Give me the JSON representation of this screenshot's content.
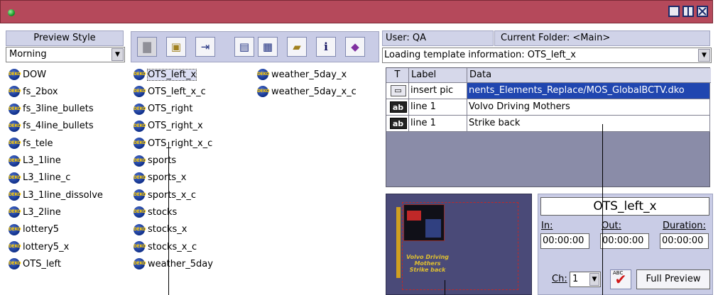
{
  "left_panel": {
    "preview_style_label": "Preview Style",
    "preview_style_value": "Morning",
    "templates_col1": [
      "DOW",
      "fs_2box",
      "fs_3line_bullets",
      "fs_4line_bullets",
      "fs_tele",
      "L3_1line",
      "L3_1line_c",
      "L3_1line_dissolve",
      "L3_2line",
      "lottery5",
      "lottery5_x",
      "OTS_left"
    ],
    "templates_col2": [
      "OTS_left_x",
      "OTS_left_x_c",
      "OTS_right",
      "OTS_right_x",
      "OTS_right_x_c",
      "sports",
      "sports_x",
      "sports_x_c",
      "stocks",
      "stocks_x",
      "stocks_x_c",
      "weather_5day"
    ],
    "templates_col3": [
      "weather_5day_x",
      "weather_5day_x_c"
    ],
    "selected_template": "OTS_left_x"
  },
  "toolbar": {
    "buttons": [
      "folder-icon",
      "template-icon",
      "import-icon",
      "list-view-icon",
      "detail-view-icon",
      "open-folder-icon",
      "info-icon",
      "eraser-icon"
    ]
  },
  "right_panel": {
    "user": "User: QA",
    "current_folder": "Current Folder: <Main>",
    "status": "Loading template information: OTS_left_x",
    "grid_headers": {
      "t": "T",
      "label": "Label",
      "data": "Data"
    },
    "grid_rows": [
      {
        "type": "picture",
        "label": "insert pic",
        "data": "nents_Elements_Replace/MOS_GlobalBCTV.dko"
      },
      {
        "type": "text",
        "label": "line 1",
        "data": "Volvo Driving Mothers"
      },
      {
        "type": "text",
        "label": "line 1",
        "data": "Strike back"
      }
    ],
    "thumbnail_caption_1": "Volvo Driving Mothers",
    "thumbnail_caption_2": "Strike back",
    "template_name": "OTS_left_x",
    "in_label": "In:",
    "out_label": "Out:",
    "duration_label": "Duration:",
    "in_value": "00:00:00",
    "out_value": "00:00:00",
    "duration_value": "00:00:00",
    "ch_label": "Ch:",
    "ch_value": "1",
    "full_preview_label": "Full Preview"
  }
}
